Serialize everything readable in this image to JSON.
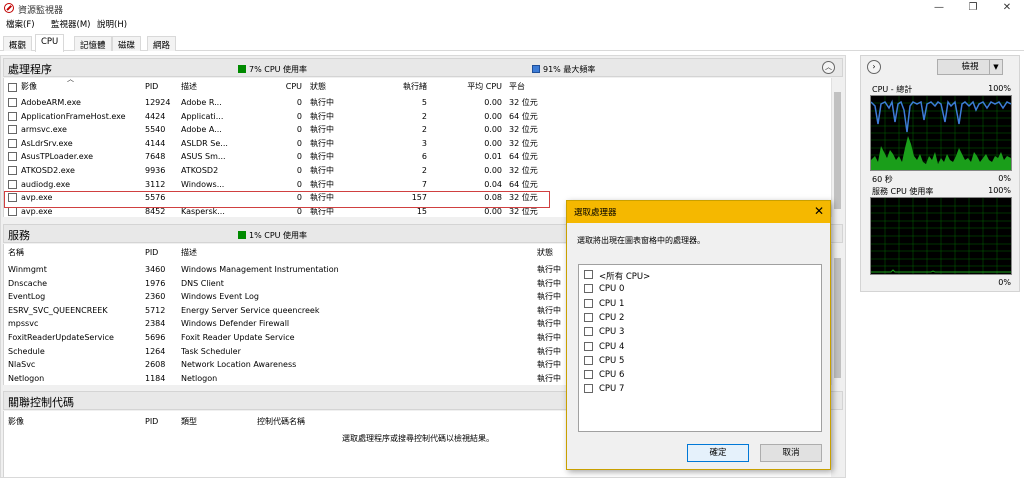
{
  "window": {
    "title": "資源監視器",
    "minimize": "—",
    "maximize": "❐",
    "close": "✕"
  },
  "menu": [
    "檔案(F)",
    "監視器(M)",
    "說明(H)"
  ],
  "tabs": [
    "概觀",
    "CPU",
    "記憶體",
    "磁碟",
    "網路"
  ],
  "processes": {
    "title": "處理程序",
    "cpu_usage": "7% CPU 使用率",
    "max_freq": "91% 最大頻率",
    "columns": [
      "影像",
      "PID",
      "描述",
      "CPU",
      "狀態",
      "執行緒",
      "平均 CPU",
      "平台"
    ],
    "rows": [
      [
        "AdobeARM.exe",
        "12924",
        "Adobe R...",
        "0",
        "執行中",
        "5",
        "0.00",
        "32 位元"
      ],
      [
        "ApplicationFrameHost.exe",
        "4424",
        "Applicati...",
        "0",
        "執行中",
        "2",
        "0.00",
        "64 位元"
      ],
      [
        "armsvc.exe",
        "5540",
        "Adobe A...",
        "0",
        "執行中",
        "2",
        "0.00",
        "32 位元"
      ],
      [
        "AsLdrSrv.exe",
        "4144",
        "ASLDR Se...",
        "0",
        "執行中",
        "3",
        "0.00",
        "32 位元"
      ],
      [
        "AsusTPLoader.exe",
        "7648",
        "ASUS Sm...",
        "0",
        "執行中",
        "6",
        "0.01",
        "64 位元"
      ],
      [
        "ATKOSD2.exe",
        "9936",
        "ATKOSD2",
        "0",
        "執行中",
        "2",
        "0.00",
        "32 位元"
      ],
      [
        "audiodg.exe",
        "3112",
        "Windows...",
        "0",
        "執行中",
        "7",
        "0.04",
        "64 位元"
      ],
      [
        "avp.exe",
        "5576",
        "",
        "0",
        "執行中",
        "157",
        "0.08",
        "32 位元"
      ],
      [
        "avp.exe",
        "8452",
        "Kaspersk...",
        "0",
        "執行中",
        "15",
        "0.00",
        "32 位元"
      ]
    ]
  },
  "services": {
    "title": "服務",
    "cpu_usage": "1% CPU 使用率",
    "columns": [
      "名稱",
      "PID",
      "描述",
      "狀態"
    ],
    "rows": [
      [
        "Winmgmt",
        "3460",
        "Windows Management Instrumentation",
        "執行中"
      ],
      [
        "Dnscache",
        "1976",
        "DNS Client",
        "執行中"
      ],
      [
        "EventLog",
        "2360",
        "Windows Event Log",
        "執行中"
      ],
      [
        "ESRV_SVC_QUEENCREEK",
        "5712",
        "Energy Server Service queencreek",
        "執行中"
      ],
      [
        "mpssvc",
        "2384",
        "Windows Defender Firewall",
        "執行中"
      ],
      [
        "FoxitReaderUpdateService",
        "5696",
        "Foxit Reader Update Service",
        "執行中"
      ],
      [
        "Schedule",
        "1264",
        "Task Scheduler",
        "執行中"
      ],
      [
        "NlaSvc",
        "2608",
        "Network Location Awareness",
        "執行中"
      ],
      [
        "Netlogon",
        "1184",
        "Netlogon",
        "執行中"
      ]
    ]
  },
  "handles": {
    "title": "關聯控制代碼",
    "columns": [
      "影像",
      "PID",
      "類型",
      "控制代碼名稱"
    ],
    "empty_text": "選取處理程序或搜尋控制代碼以檢視結果。"
  },
  "side": {
    "view_button": "檢視",
    "graph1_title": "CPU - 總計",
    "graph1_max": "100%",
    "graph1_time": "60 秒",
    "graph1_min": "0%",
    "graph2_title": "服務 CPU 使用率",
    "graph2_max": "100%",
    "graph2_min": "0%"
  },
  "dialog": {
    "title": "選取處理器",
    "instruction": "選取將出現在圖表窗格中的處理器。",
    "items": [
      "<所有 CPU>",
      "CPU 0",
      "CPU 1",
      "CPU 2",
      "CPU 3",
      "CPU 4",
      "CPU 5",
      "CPU 6",
      "CPU 7"
    ],
    "ok": "確定",
    "cancel": "取消"
  },
  "colors": {
    "cpu_green": "#008a00",
    "freq_blue": "#3d7cd6",
    "dialog_title_bg": "#f5b800"
  }
}
